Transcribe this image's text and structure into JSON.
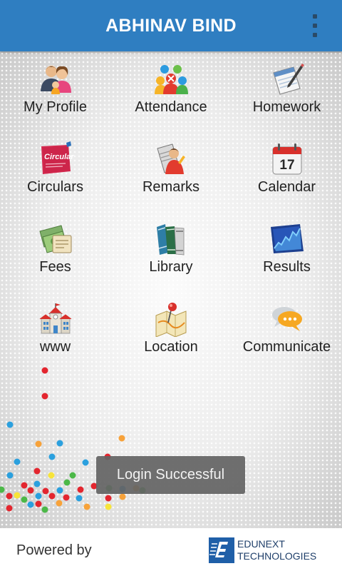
{
  "header": {
    "title": "ABHINAV BIND"
  },
  "tiles": [
    {
      "label": "My Profile",
      "icon": "profile-people-icon"
    },
    {
      "label": "Attendance",
      "icon": "attendance-icon"
    },
    {
      "label": "Homework",
      "icon": "homework-notepad-icon"
    },
    {
      "label": "Circulars",
      "icon": "circular-notice-icon"
    },
    {
      "label": "Remarks",
      "icon": "remarks-icon"
    },
    {
      "label": "Calendar",
      "icon": "calendar-icon"
    },
    {
      "label": "Fees",
      "icon": "fees-money-icon"
    },
    {
      "label": "Library",
      "icon": "library-books-icon"
    },
    {
      "label": "Results",
      "icon": "results-chart-icon"
    },
    {
      "label": "www",
      "icon": "school-building-icon"
    },
    {
      "label": "Location",
      "icon": "location-map-icon"
    },
    {
      "label": "Communicate",
      "icon": "chat-bubbles-icon"
    }
  ],
  "icon_text": {
    "circular_badge": "Circular",
    "calendar_day": "17"
  },
  "toast": {
    "message": "Login Successful"
  },
  "footer": {
    "powered_by": "Powered by",
    "brand_line1": "EDUNEXT",
    "brand_line2": "TECHNOLOGIES"
  },
  "colors": {
    "header_bg": "#2f7ec1",
    "header_text": "#ffffff",
    "brand": "#1f5fa8"
  }
}
